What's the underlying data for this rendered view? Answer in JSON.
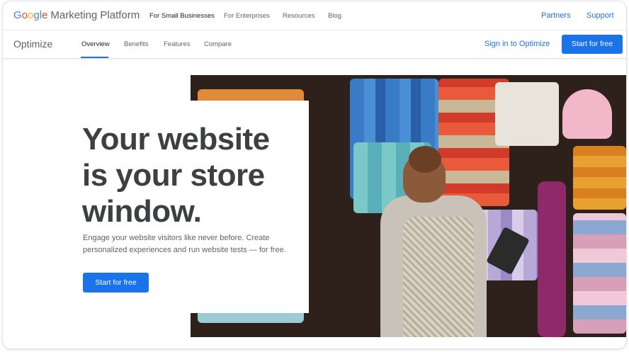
{
  "brand": {
    "logo_letters": [
      "G",
      "o",
      "o",
      "g",
      "l",
      "e"
    ],
    "logo_rest": "Marketing Platform"
  },
  "top_nav": {
    "items": [
      "For Small Businesses",
      "For Enterprises",
      "Resources",
      "Blog"
    ],
    "partners": "Partners",
    "support": "Support"
  },
  "sub_nav": {
    "product": "Optimize",
    "items": [
      "Overview",
      "Benefits",
      "Features",
      "Compare"
    ],
    "sign_in": "Sign in to Optimize",
    "cta": "Start for free"
  },
  "hero": {
    "headline": "Your website is your store window.",
    "description": "Engage your website visitors like never before. Create personalized experiences and run website tests — for free.",
    "cta": "Start for free"
  },
  "colors": {
    "accent": "#1a73e8",
    "text": "#3c4043",
    "muted": "#5f6368"
  }
}
